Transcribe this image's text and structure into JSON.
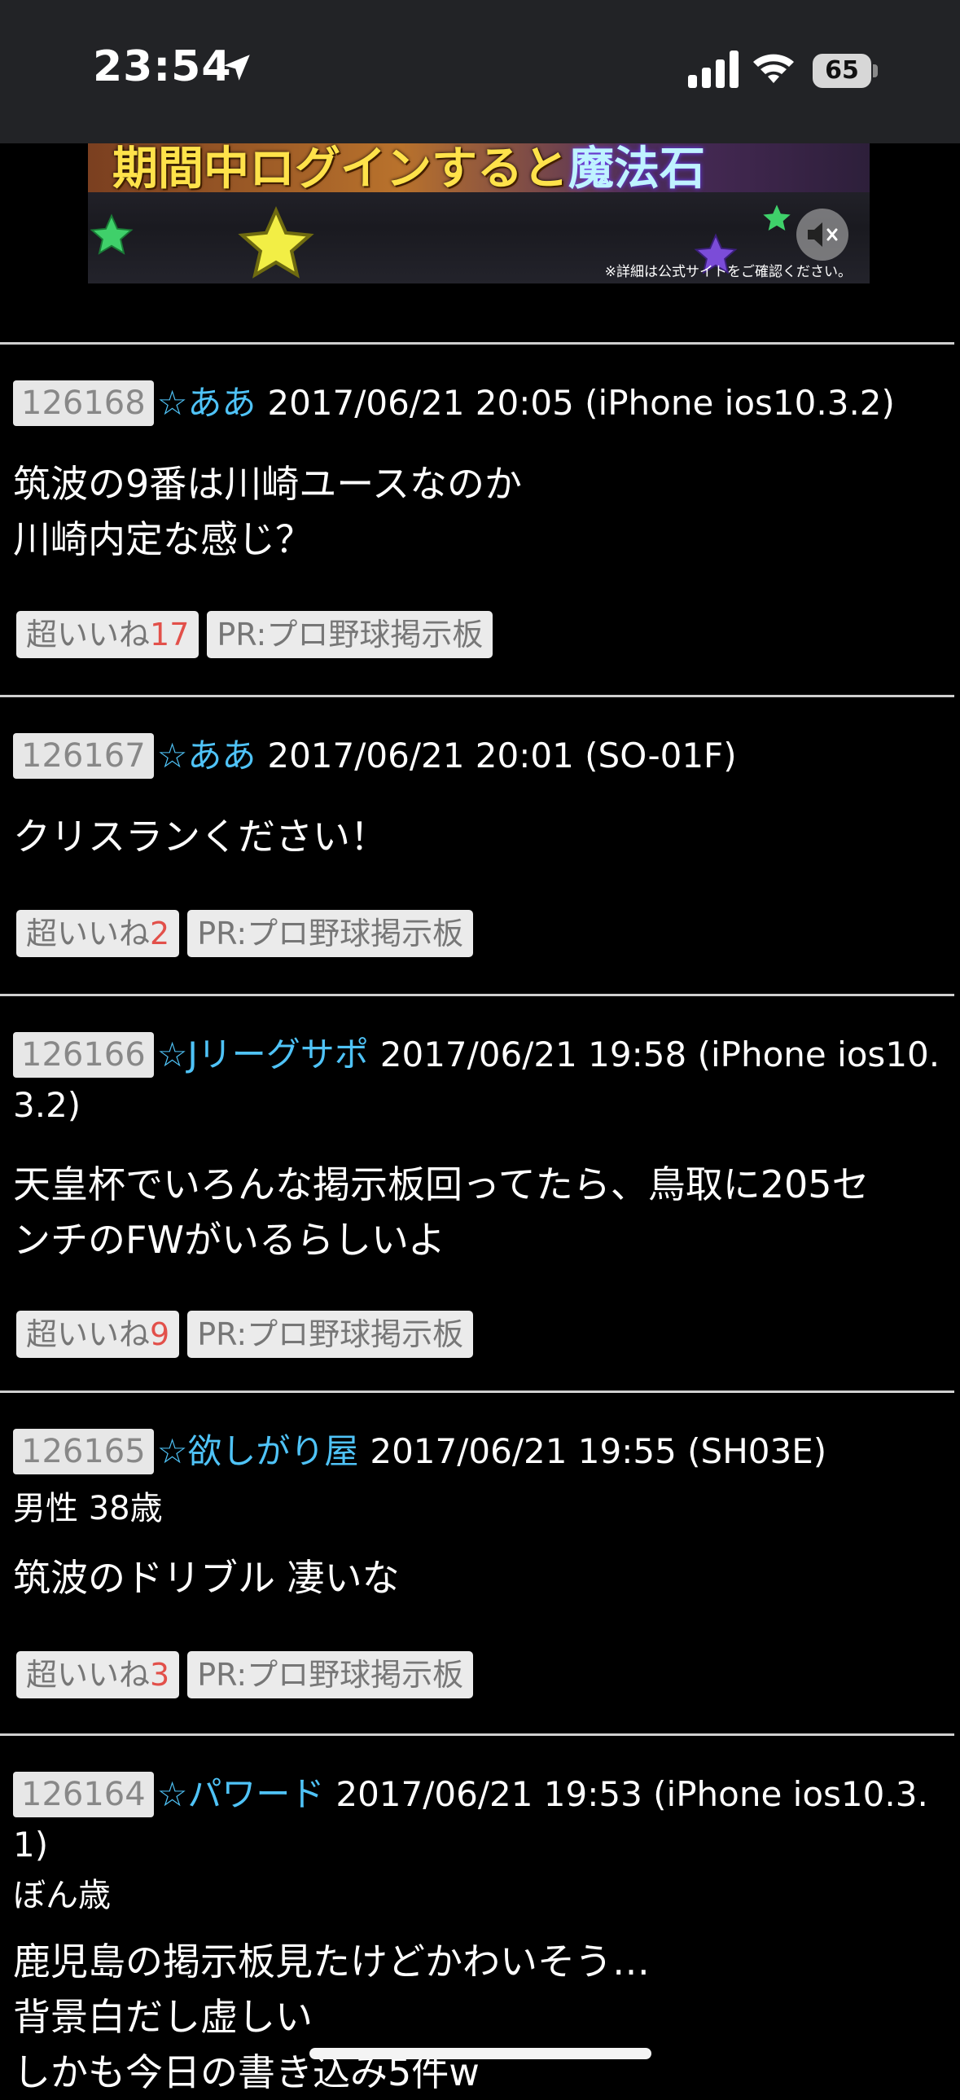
{
  "status_bar": {
    "time": "23:54",
    "battery": "65",
    "icons": [
      "location-arrow-icon",
      "cellular-signal-icon",
      "wifi-icon",
      "battery-icon"
    ]
  },
  "ad": {
    "headline_main": "期間中ログインすると",
    "headline_accent": "魔法石",
    "note": "※詳細は公式サイトをご確認ください。",
    "icons": [
      "star-icon",
      "mute-icon"
    ]
  },
  "posts": [
    {
      "number": "126168",
      "name": "☆ああ",
      "meta": "2017/06/21 20:05 (iPhone ios10.3.2)",
      "extra": "",
      "lines": [
        "筑波の9番は川崎ユースなのか",
        "川崎内定な感じ？"
      ],
      "like_label": "超いいね",
      "like_count": "17",
      "pr_label": "PR:プロ野球掲示板"
    },
    {
      "number": "126167",
      "name": "☆ああ",
      "meta": "2017/06/21 20:01 (SO-01F)",
      "extra": "",
      "lines": [
        "クリスランください！"
      ],
      "like_label": "超いいね",
      "like_count": "2",
      "pr_label": "PR:プロ野球掲示板"
    },
    {
      "number": "126166",
      "name": "☆Jリーグサポ",
      "meta": "2017/06/21 19:58 (iPhone ios10.3.2)",
      "extra": "",
      "lines": [
        "天皇杯でいろんな掲示板回ってたら、鳥取に205セ",
        "ンチのFWがいるらしいよ"
      ],
      "like_label": "超いいね",
      "like_count": "9",
      "pr_label": "PR:プロ野球掲示板"
    },
    {
      "number": "126165",
      "name": "☆欲しがり屋",
      "meta": "2017/06/21 19:55 (SH03E)",
      "extra": "男性 38歳",
      "lines": [
        "筑波のドリブル 凄いな"
      ],
      "like_label": "超いいね",
      "like_count": "3",
      "pr_label": "PR:プロ野球掲示板"
    },
    {
      "number": "126164",
      "name": "☆パワード",
      "meta": "2017/06/21 19:53 (iPhone ios10.3.1)",
      "extra": "ぼん歳",
      "lines": [
        "鹿児島の掲示板見たけどかわいそう…",
        "背景白だし虚しい",
        "しかも今日の書き込み5件w"
      ],
      "like_label": "",
      "like_count": "",
      "pr_label": ""
    }
  ]
}
